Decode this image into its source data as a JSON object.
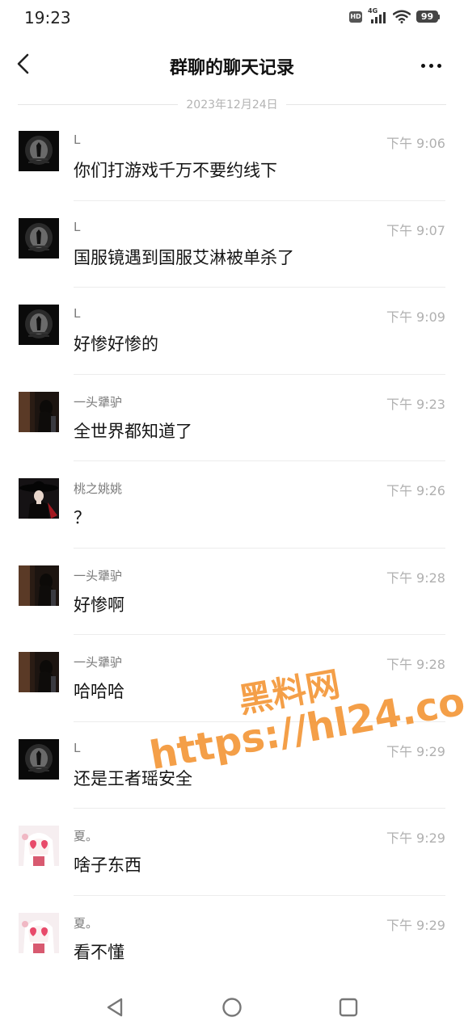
{
  "status_bar": {
    "time": "19:23",
    "hd_badge": "HD",
    "network": "4G",
    "battery": "99"
  },
  "header": {
    "title": "群聊的聊天记录"
  },
  "date_divider": "2023年12月24日",
  "messages": [
    {
      "sender": "L",
      "time": "下午 9:06",
      "text": "你们打游戏千万不要约线下",
      "avatar": "dark-tunnel-avatar"
    },
    {
      "sender": "L",
      "time": "下午 9:07",
      "text": "国服镜遇到国服艾淋被单杀了",
      "avatar": "dark-tunnel-avatar"
    },
    {
      "sender": "L",
      "time": "下午 9:09",
      "text": "好惨好惨的",
      "avatar": "dark-tunnel-avatar"
    },
    {
      "sender": "一头犟驴",
      "time": "下午 9:23",
      "text": "全世界都知道了",
      "avatar": "dark-silhouette-avatar"
    },
    {
      "sender": "桃之姚姚",
      "time": "下午 9:26",
      "text": "？",
      "avatar": "witch-hat-avatar"
    },
    {
      "sender": "一头犟驴",
      "time": "下午 9:28",
      "text": "好惨啊",
      "avatar": "dark-silhouette-avatar"
    },
    {
      "sender": "一头犟驴",
      "time": "下午 9:28",
      "text": "哈哈哈",
      "avatar": "dark-silhouette-avatar"
    },
    {
      "sender": "L",
      "time": "下午 9:29",
      "text": "还是王者瑶安全",
      "avatar": "dark-tunnel-avatar"
    },
    {
      "sender": "夏。",
      "time": "下午 9:29",
      "text": "啥子东西",
      "avatar": "anime-girl-avatar"
    },
    {
      "sender": "夏。",
      "time": "下午 9:29",
      "text": "看不懂",
      "avatar": "anime-girl-avatar"
    }
  ],
  "watermark": {
    "title": "黑料网",
    "url": "https://hl24.co"
  },
  "colors": {
    "watermark": "#f28e28",
    "time_text": "#b0b0b0",
    "sender_text": "#7a7a7a"
  }
}
